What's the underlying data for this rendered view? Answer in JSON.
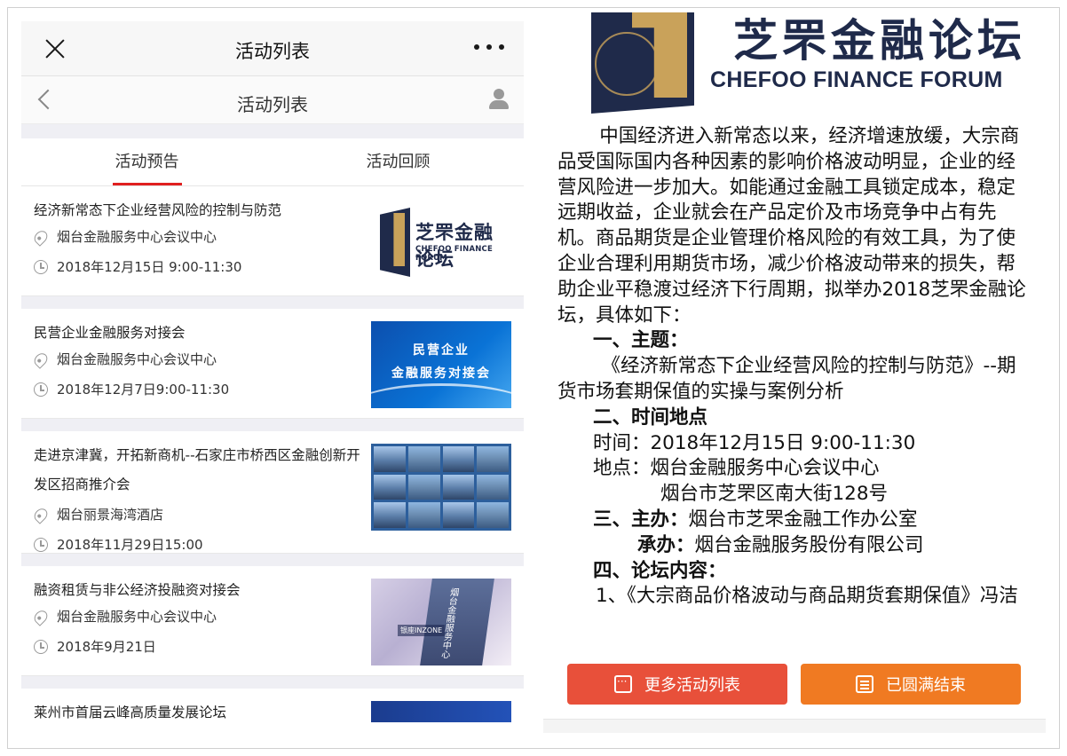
{
  "left": {
    "topbar": {
      "title": "活动列表"
    },
    "navbar": {
      "title": "活动列表"
    },
    "tabs": [
      {
        "label": "活动预告",
        "active": true
      },
      {
        "label": "活动回顾",
        "active": false
      }
    ],
    "events": [
      {
        "title": "经济新常态下企业经营风险的控制与防范",
        "location": "烟台金融服务中心会议中心",
        "time": "2018年12月15日 9:00-11:30",
        "thumb": {
          "cn": "芝罘金融论坛",
          "en": "CHEFOO FINANCE FORUM"
        }
      },
      {
        "title": "民营企业金融服务对接会",
        "location": "烟台金融服务中心会议中心",
        "time": "2018年12月7日9:00-11:30",
        "thumb": {
          "line1": "民营企业",
          "line2": "金融服务对接会"
        }
      },
      {
        "title": "走进京津冀，开拓新商机--石家庄市桥西区金融创新开发区招商推介会",
        "location": "烟台丽景海湾酒店",
        "time": "2018年11月29日15:00"
      },
      {
        "title": "融资租赁与非公经济投融资对接会",
        "location": "烟台金融服务中心会议中心",
        "time": "2018年9月21日",
        "thumb": {
          "vertical": "烟台金融服务中心",
          "sign": "银座INZONE"
        }
      },
      {
        "title": "莱州市首届云峰高质量发展论坛"
      }
    ]
  },
  "right": {
    "logo": {
      "cn": "芝罘金融论坛",
      "en": "CHEFOO FINANCE FORUM"
    },
    "article": {
      "intro": "中国经济进入新常态以来，经济增速放缓，大宗商品受国际国内各种因素的影响价格波动明显，企业的经营风险进一步加大。如能通过金融工具锁定成本，稳定远期收益，企业就会在产品定价及市场竞争中占有先机。商品期货是企业管理价格风险的有效工具，为了使企业合理利用期货市场，减少价格波动带来的损失，帮助企业平稳渡过经济下行周期，拟举办2018芝罘金融论坛，具体如下：",
      "s1_heading": "一、主题：",
      "s1_body": "《经济新常态下企业经营风险的控制与防范》--期货市场套期保值的实操与案例分析",
      "s2_heading": "二、时间地点",
      "time_line": "时间：2018年12月15日 9:00-11:30",
      "place_line": "地点：烟台金融服务中心会议中心",
      "place_line2": "烟台市芝罘区南大街128号",
      "s3_heading": "三、主办：",
      "s3_host": "烟台市芝罘金融工作办公室",
      "s3_co_label": "承办：",
      "s3_co": "烟台金融服务股份有限公司",
      "s4_heading": "四、论坛内容：",
      "s4_item1": "1、《大宗商品价格波动与商品期货套期保值》冯洁"
    },
    "buttons": {
      "more": "更多活动列表",
      "ended": "已圆满结束"
    }
  }
}
